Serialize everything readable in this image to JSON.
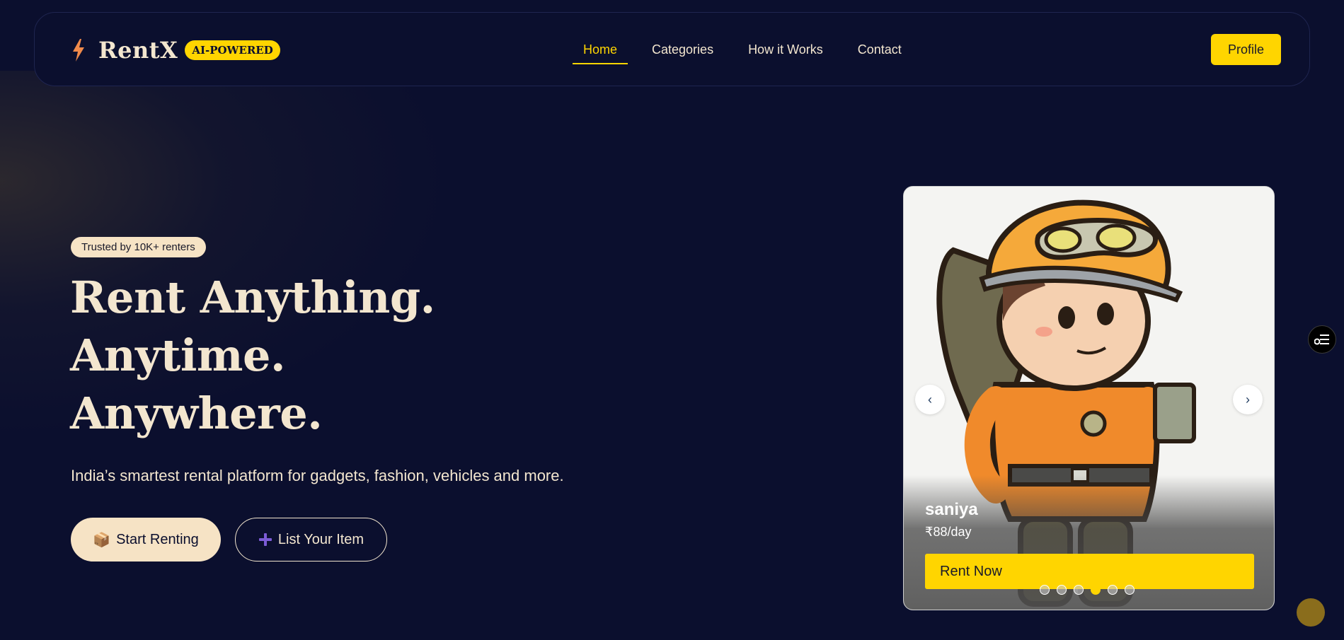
{
  "header": {
    "brand": "RentX",
    "badge": "AI-POWERED",
    "logo_icon": "lightning-bolt-icon",
    "nav": [
      {
        "label": "Home",
        "active": true
      },
      {
        "label": "Categories",
        "active": false
      },
      {
        "label": "How it Works",
        "active": false
      },
      {
        "label": "Contact",
        "active": false
      }
    ],
    "profile_label": "Profile"
  },
  "hero": {
    "trusted_badge": "Trusted by 10K+ renters",
    "headline": [
      "Rent Anything.",
      "Anytime.",
      "Anywhere."
    ],
    "subtitle": "India’s smartest rental platform for gadgets, fashion, vehicles and more.",
    "primary_button": {
      "icon": "📦",
      "label": "Start Renting"
    },
    "secondary_button": {
      "icon": "plus-icon",
      "label": "List Your Item"
    }
  },
  "carousel": {
    "item_name": "saniya",
    "item_price": "₹88/day",
    "cta": "Rent Now",
    "prev_label": "‹",
    "next_label": "›",
    "slide_count": 6,
    "active_slide": 3
  },
  "colors": {
    "background": "#0b0f2e",
    "accent": "#ffd500",
    "cream": "#f3e6cf",
    "plus_icon": "#7c5cd6"
  }
}
